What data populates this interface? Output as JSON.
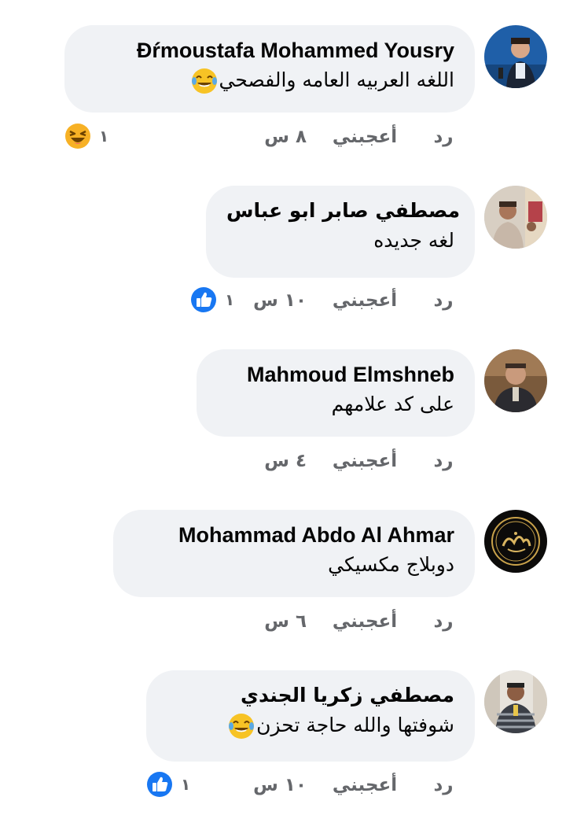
{
  "comments": [
    {
      "name": "Đŕmoustafa Mohammed Yousry",
      "text": "اللغه العربيه العامه والفصحي",
      "time": "٨ س",
      "like": "أعجبني",
      "reply": "رد",
      "reaction_count": "١",
      "reaction_icon": "laugh-reaction-icon"
    },
    {
      "name": "مصطفي صابر ابو عباس",
      "text": "لغه جديده",
      "time": "١٠ س",
      "like": "أعجبني",
      "reply": "رد",
      "reaction_count": "١",
      "reaction_icon": "like-reaction-icon"
    },
    {
      "name": "Mahmoud Elmshneb",
      "text": "على كد علامهم",
      "time": "٤ س",
      "like": "أعجبني",
      "reply": "رد"
    },
    {
      "name": "Mohammad Abdo Al Ahmar",
      "text": "دوبلاج مكسيكي",
      "time": "٦ س",
      "like": "أعجبني",
      "reply": "رد"
    },
    {
      "name": "مصطفي زكريا الجندي",
      "text": "شوفتها والله حاجة تحزن",
      "time": "١٠ س",
      "like": "أعجبني",
      "reply": "رد",
      "reaction_count": "١",
      "reaction_icon": "like-reaction-icon"
    }
  ],
  "colors": {
    "bubble": "#f0f2f5",
    "meta_text": "#65676b",
    "like_blue": "#1877f2",
    "laugh_yellow": "#f7b125"
  }
}
